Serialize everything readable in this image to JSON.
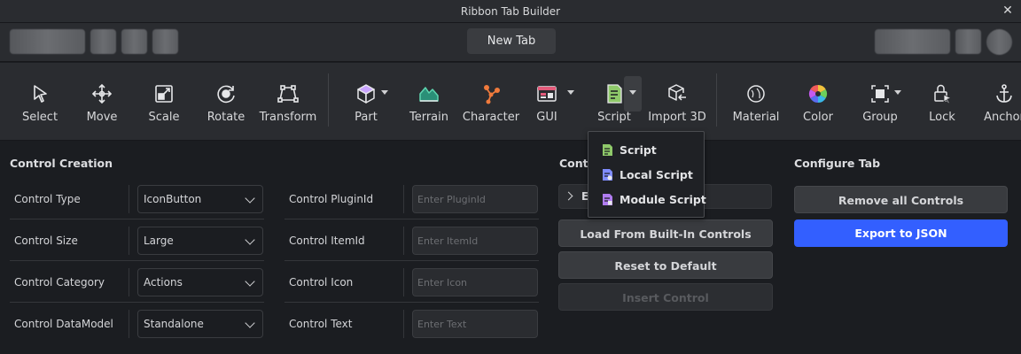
{
  "window": {
    "title": "Ribbon Tab Builder",
    "close_glyph": "✕"
  },
  "topbar": {
    "new_tab_label": "New Tab"
  },
  "ribbon": {
    "tools": [
      {
        "id": "select",
        "label": "Select",
        "icon": "cursor-arrow-icon"
      },
      {
        "id": "move",
        "label": "Move",
        "icon": "move-arrows-icon"
      },
      {
        "id": "scale",
        "label": "Scale",
        "icon": "scale-box-icon"
      },
      {
        "id": "rotate",
        "label": "Rotate",
        "icon": "rotate-icon"
      },
      {
        "id": "transform",
        "label": "Transform",
        "icon": "transform-icon"
      },
      {
        "id": "part",
        "label": "Part",
        "icon": "cube-icon",
        "color": "#c9a4ff"
      },
      {
        "id": "terrain",
        "label": "Terrain",
        "icon": "terrain-icon",
        "color": "#5ed6b0"
      },
      {
        "id": "character",
        "label": "Character",
        "icon": "character-rig-icon",
        "color": "#f07a3c"
      },
      {
        "id": "gui",
        "label": "GUI",
        "icon": "gui-window-icon",
        "color": "#e35a7a"
      },
      {
        "id": "script",
        "label": "Script",
        "icon": "script-icon",
        "color": "#8fc96a"
      },
      {
        "id": "import3d",
        "label": "Import 3D",
        "icon": "import-3d-icon"
      },
      {
        "id": "material",
        "label": "Material",
        "icon": "material-sphere-icon"
      },
      {
        "id": "color",
        "label": "Color",
        "icon": "color-wheel-icon"
      },
      {
        "id": "group",
        "label": "Group",
        "icon": "group-icon"
      },
      {
        "id": "lock",
        "label": "Lock",
        "icon": "lock-icon"
      },
      {
        "id": "anchor",
        "label": "Anchor",
        "icon": "anchor-icon"
      }
    ]
  },
  "control_creation": {
    "title": "Control Creation",
    "rows": [
      {
        "label": "Control Type",
        "value": "IconButton"
      },
      {
        "label": "Control Size",
        "value": "Large"
      },
      {
        "label": "Control Category",
        "value": "Actions"
      },
      {
        "label": "Control DataModel",
        "value": "Standalone"
      }
    ],
    "fields": [
      {
        "label": "Control PluginId",
        "placeholder": "Enter PluginId"
      },
      {
        "label": "Control ItemId",
        "placeholder": "Enter ItemId"
      },
      {
        "label": "Control Icon",
        "placeholder": "Enter Icon"
      },
      {
        "label": "Control Text",
        "placeholder": "Enter Text"
      }
    ]
  },
  "controls_panel": {
    "title": "Contr",
    "expander_label": "E",
    "load_label": "Load From Built-In Controls",
    "reset_label": "Reset to Default",
    "insert_label": "Insert Control"
  },
  "configure_tab": {
    "title": "Configure Tab",
    "remove_label": "Remove all Controls",
    "export_label": "Export to JSON"
  },
  "script_menu": {
    "items": [
      {
        "label": "Script",
        "icon": "script-icon",
        "color": "#8fc96a"
      },
      {
        "label": "Local Script",
        "icon": "local-script-icon",
        "color": "#7f8cff"
      },
      {
        "label": "Module Script",
        "icon": "module-script-icon",
        "color": "#b07cf0"
      }
    ]
  },
  "colors": {
    "accent": "#335fff",
    "background": "#1b1d21",
    "panel": "#2a2c30"
  }
}
